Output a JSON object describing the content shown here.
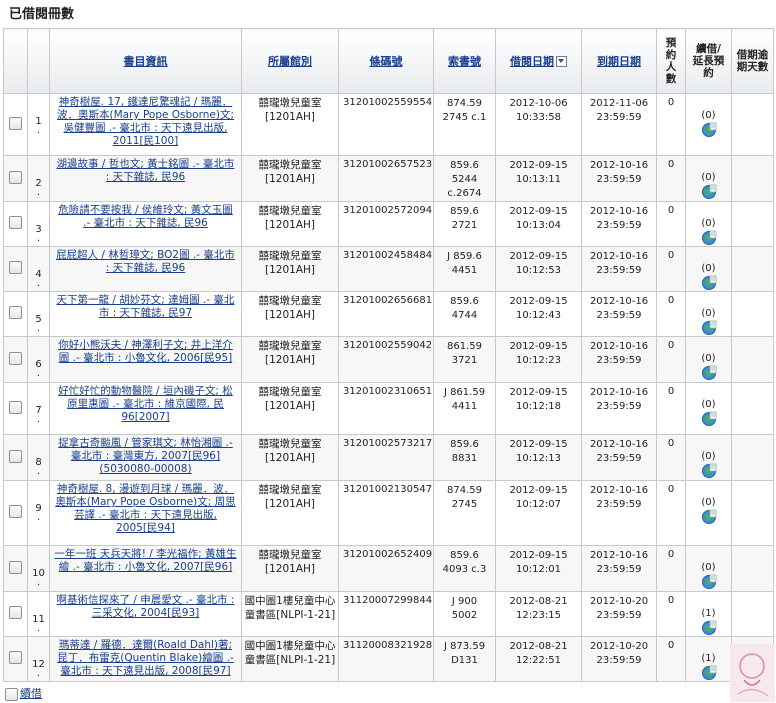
{
  "page_title": "已借閱冊數",
  "columns": {
    "title": "書目資訊",
    "location": "所屬館別",
    "barcode": "條碼號",
    "call_no": "索書號",
    "loan_date": "借閱日期",
    "due_date": "到期日期",
    "holds": "預約人數",
    "renew": "續借/延長預約",
    "overdue": "借期逾期天數"
  },
  "rows": [
    {
      "n": "1",
      "title": "神奇樹屋. 17, 鐵達尼驚魂記 / 瑪麗．波．奧斯本(Mary Pope Osborne)文; 吳健豐圖 .- 臺北市 : 天下遠見出版, 2011[民100]",
      "loc1": "囍瓏墩兒童室",
      "loc2": "[1201AH]",
      "barcode": "31201002559554",
      "call1": "874.59",
      "call2": "2745 c.1",
      "call3": "",
      "ld1": "2012-10-06",
      "ld2": "10:33:58",
      "dd1": "2012-11-06",
      "dd2": "23:59:59",
      "holds": "0",
      "renew": "(0)"
    },
    {
      "n": "2",
      "title": "湖邊故事 / 哲也文; 黃士銘圖 .- 臺北市 : 天下雜誌, 民96",
      "loc1": "囍瓏墩兒童室",
      "loc2": "[1201AH]",
      "barcode": "31201002657523",
      "call1": "859.6",
      "call2": "5244",
      "call3": "c.2674",
      "ld1": "2012-09-15",
      "ld2": "10:13:11",
      "dd1": "2012-10-16",
      "dd2": "23:59:59",
      "holds": "0",
      "renew": "(0)"
    },
    {
      "n": "3",
      "title": "危險請不要按我 / 侯維玲文; 黃文玉圖 .- 臺北市 : 天下雜誌, 民96",
      "loc1": "囍瓏墩兒童室",
      "loc2": "[1201AH]",
      "barcode": "31201002572094",
      "call1": "859.6",
      "call2": "2721",
      "call3": "",
      "ld1": "2012-09-15",
      "ld2": "10:13:04",
      "dd1": "2012-10-16",
      "dd2": "23:59:59",
      "holds": "0",
      "renew": "(0)"
    },
    {
      "n": "4",
      "title": "屁屁超人 / 林哲璋文; BO2圖 .- 臺北市 : 天下雜誌, 民96",
      "loc1": "囍瓏墩兒童室",
      "loc2": "[1201AH]",
      "barcode": "31201002458484",
      "call1": "J 859.6",
      "call2": "4451",
      "call3": "",
      "ld1": "2012-09-15",
      "ld2": "10:12:53",
      "dd1": "2012-10-16",
      "dd2": "23:59:59",
      "holds": "0",
      "renew": "(0)"
    },
    {
      "n": "5",
      "title": "天下第一龍 / 胡妙芬文; 達姆圖 .- 臺北市 : 天下雜誌, 民97",
      "loc1": "囍瓏墩兒童室",
      "loc2": "[1201AH]",
      "barcode": "31201002656681",
      "call1": "859.6",
      "call2": "4744",
      "call3": "",
      "ld1": "2012-09-15",
      "ld2": "10:12:43",
      "dd1": "2012-10-16",
      "dd2": "23:59:59",
      "holds": "0",
      "renew": "(0)"
    },
    {
      "n": "6",
      "title": "你好小熊沃夫 / 神澤利子文; 井上洋介圖 .- 臺北市 : 小魯文化, 2006[民95]",
      "loc1": "囍瓏墩兒童室",
      "loc2": "[1201AH]",
      "barcode": "31201002559042",
      "call1": "861.59",
      "call2": "3721",
      "call3": "",
      "ld1": "2012-09-15",
      "ld2": "10:12:23",
      "dd1": "2012-10-16",
      "dd2": "23:59:59",
      "holds": "0",
      "renew": "(0)"
    },
    {
      "n": "7",
      "title": "好忙好忙的動物醫院 / 垣內磯子文; 松原里惠圖 .- 臺北市 : 維京國際, 民96[2007]",
      "loc1": "囍瓏墩兒童室",
      "loc2": "[1201AH]",
      "barcode": "31201002310651",
      "call1": "J 861.59",
      "call2": "4411",
      "call3": "",
      "ld1": "2012-09-15",
      "ld2": "10:12:18",
      "dd1": "2012-10-16",
      "dd2": "23:59:59",
      "holds": "0",
      "renew": "(0)"
    },
    {
      "n": "8",
      "title": "捉拿古奇颱風 / 管家琪文; 林怡湘圖 .- 臺北市 : 臺灣東方, 2007[民96] (5030080-00008)",
      "loc1": "囍瓏墩兒童室",
      "loc2": "[1201AH]",
      "barcode": "31201002573217",
      "call1": "859.6",
      "call2": "8831",
      "call3": "",
      "ld1": "2012-09-15",
      "ld2": "10:12:13",
      "dd1": "2012-10-16",
      "dd2": "23:59:59",
      "holds": "0",
      "renew": "(0)"
    },
    {
      "n": "9",
      "title": "神奇樹屋. 8, 漫遊到月球 / 瑪麗．波．奧斯本(Mary Pope Osborne)文; 周思芸譯 .- 臺北市 : 天下遠見出版, 2005[民94]",
      "loc1": "囍瓏墩兒童室",
      "loc2": "[1201AH]",
      "barcode": "31201002130547",
      "call1": "874.59",
      "call2": "2745",
      "call3": "",
      "ld1": "2012-09-15",
      "ld2": "10:12:07",
      "dd1": "2012-10-16",
      "dd2": "23:59:59",
      "holds": "0",
      "renew": "(0)"
    },
    {
      "n": "10",
      "title": "一年一班 天兵天將! / 李光福作; 黃雄生繪 .- 臺北市 : 小魯文化, 2007[民96]",
      "loc1": "囍瓏墩兒童室",
      "loc2": "[1201AH]",
      "barcode": "31201002652409",
      "call1": "859.6",
      "call2": "4093 c.3",
      "call3": "",
      "ld1": "2012-09-15",
      "ld2": "10:12:01",
      "dd1": "2012-10-16",
      "dd2": "23:59:59",
      "holds": "0",
      "renew": "(0)"
    },
    {
      "n": "11",
      "title": "啊基術信探來了 / 申晨愛文 .- 臺北市 : 三采文化, 2004[民93]",
      "loc1": "國中圖1樓兒童中心童書區[NLPI-1-21]",
      "loc2": "",
      "barcode": "31120007299844",
      "call1": "J 900",
      "call2": "5002",
      "call3": "",
      "ld1": "2012-08-21",
      "ld2": "12:23:15",
      "dd1": "2012-10-20",
      "dd2": "23:59:59",
      "holds": "0",
      "renew": "(1)"
    },
    {
      "n": "12",
      "title": "瑪蒂達 / 羅德．達爾(Roald Dahl)著; 昆丁．布雷克(Quentin Blake)繪圖 .- 臺北市 : 天下遠見出版, 2008[民97]",
      "loc1": "國中圖1樓兒童中心童書區[NLPI-1-21]",
      "loc2": "",
      "barcode": "31120008321928",
      "call1": "J 873.59",
      "call2": "D131",
      "call3": "",
      "ld1": "2012-08-21",
      "ld2": "12:22:51",
      "dd1": "2012-10-20",
      "dd2": "23:59:59",
      "holds": "0",
      "renew": "(1)"
    }
  ],
  "footer": {
    "renew_label": "續借"
  },
  "icons": {
    "sort": "sort-down-icon",
    "renew": "globe-renew-icon"
  },
  "colors": {
    "link": "#1a3f8c",
    "border": "#c9c9c9"
  }
}
